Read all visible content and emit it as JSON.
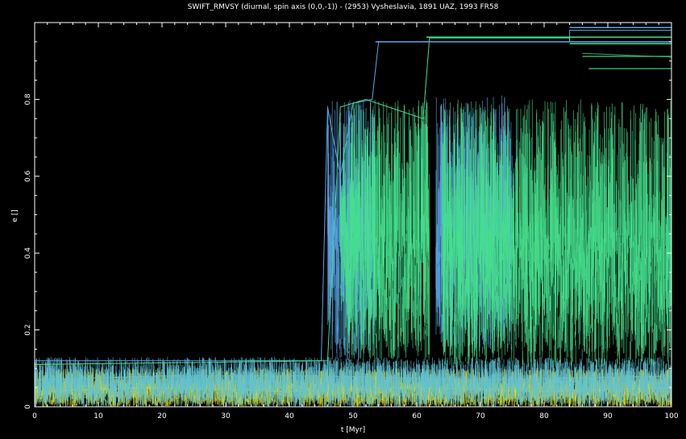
{
  "chart_data": {
    "type": "scatter",
    "title": "SWIFT_RMVSY (diurnal, spin axis (0,0,-1)) - (2953) Vysheslavia, 1891 UAZ, 1993 FR58",
    "xlabel": "t [Myr]",
    "ylabel": "e []",
    "xlim": [
      0,
      100
    ],
    "ylim": [
      0,
      1
    ],
    "xticks": [
      0,
      10,
      20,
      30,
      40,
      50,
      60,
      70,
      80,
      90,
      100
    ],
    "yticks": [
      0,
      0.2,
      0.4,
      0.6,
      0.8
    ],
    "x_tick_labels": [
      "0",
      "10",
      "20",
      "30",
      "40",
      "50",
      "60",
      "70",
      "80",
      "90",
      "100"
    ],
    "y_tick_labels": [
      "0",
      "0.2",
      "0.4",
      "0.6",
      "0.8"
    ],
    "background": "#000000",
    "axis_color": "#ffffff",
    "grid": false,
    "legend": "none",
    "series": [
      {
        "color": "#f2e200",
        "points": [
          [
            0,
            0.04
          ],
          [
            20,
            0.05
          ],
          [
            40,
            0.04
          ],
          [
            60,
            0.05
          ],
          [
            80,
            0.04
          ],
          [
            100,
            0.05
          ]
        ],
        "band": [
          0.0,
          0.1
        ],
        "range": [
          0,
          100
        ]
      },
      {
        "color": "#5fc2d6",
        "points": [
          [
            0,
            0.07
          ],
          [
            20,
            0.08
          ],
          [
            45,
            0.08
          ],
          [
            70,
            0.07
          ],
          [
            100,
            0.08
          ]
        ],
        "band": [
          0.0,
          0.13
        ],
        "range": [
          0,
          100
        ]
      },
      {
        "color": "#5aa6e8",
        "points": [
          [
            0,
            0.12
          ],
          [
            45,
            0.12
          ],
          [
            46,
            0.78
          ],
          [
            48,
            0.6
          ],
          [
            50,
            0.79
          ],
          [
            53,
            0.8
          ],
          [
            54,
            0.95
          ],
          [
            84,
            0.95
          ],
          [
            84,
            0.98
          ],
          [
            100,
            0.98
          ]
        ],
        "band": [
          0.12,
          0.8
        ],
        "range": [
          46,
          53.5
        ],
        "band2": [
          0.15,
          0.81
        ],
        "range2": [
          63,
          75
        ]
      },
      {
        "color": "#46e08e",
        "points": [
          [
            0,
            0.11
          ],
          [
            46,
            0.12
          ],
          [
            48,
            0.78
          ],
          [
            52,
            0.8
          ],
          [
            61,
            0.75
          ],
          [
            62,
            0.96
          ],
          [
            84,
            0.96
          ],
          [
            84,
            0.95
          ],
          [
            100,
            0.95
          ]
        ],
        "band": [
          0.12,
          0.8
        ],
        "range": [
          48,
          62
        ],
        "band2": [
          0.1,
          0.8
        ],
        "range2": [
          64,
          100
        ]
      },
      {
        "color": "#3aa862",
        "points": [
          [
            86,
            0.92
          ],
          [
            100,
            0.91
          ]
        ]
      }
    ],
    "jump_lines": [
      {
        "color": "#5aa6e8",
        "x": [
          53.5,
          100
        ],
        "y": 0.95
      },
      {
        "color": "#46e08e",
        "x": [
          61.5,
          100
        ],
        "y": 0.962
      },
      {
        "color": "#5aa6e8",
        "x": [
          84,
          100
        ],
        "y": 0.987
      },
      {
        "color": "#46e08e",
        "x": [
          84,
          100
        ],
        "y": 0.945
      },
      {
        "color": "#3aa862",
        "x": [
          86,
          100
        ],
        "y": 0.912
      },
      {
        "color": "#3aa862",
        "x": [
          87,
          100
        ],
        "y": 0.88
      }
    ]
  }
}
